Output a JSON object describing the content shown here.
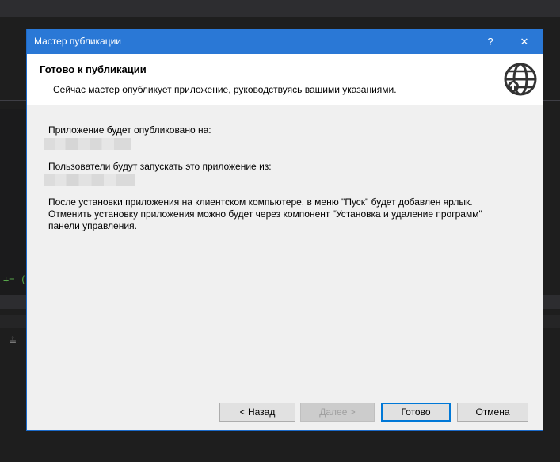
{
  "dialog": {
    "title": "Мастер публикации",
    "help_glyph": "?",
    "close_glyph": "✕"
  },
  "header": {
    "title": "Готово к публикации",
    "subtitle": "Сейчас мастер опубликует приложение, руководствуясь вашими указаниями."
  },
  "body": {
    "publish_to_label": "Приложение будет опубликовано на:",
    "launch_from_label": "Пользователи будут запускать это приложение из:",
    "note_line1": "После установки приложения на клиентском компьютере, в меню \"Пуск\" будет добавлен ярлык.",
    "note_line2": "Отменить установку приложения можно будет через компонент \"Установка и удаление программ\"",
    "note_line3": "панели управления."
  },
  "buttons": {
    "back": "< Назад",
    "next": "Далее >",
    "finish": "Готово",
    "cancel": "Отмена"
  },
  "background": {
    "code_fragment": "+= (",
    "gutter_glyph": "≟"
  },
  "icons": [
    "globe-icon",
    "help-icon",
    "close-icon"
  ],
  "colors": {
    "titlebar": "#2a78d6",
    "dialog_bg": "#f0f0f0",
    "header_bg": "#ffffff",
    "default_button_border": "#0078d7"
  }
}
